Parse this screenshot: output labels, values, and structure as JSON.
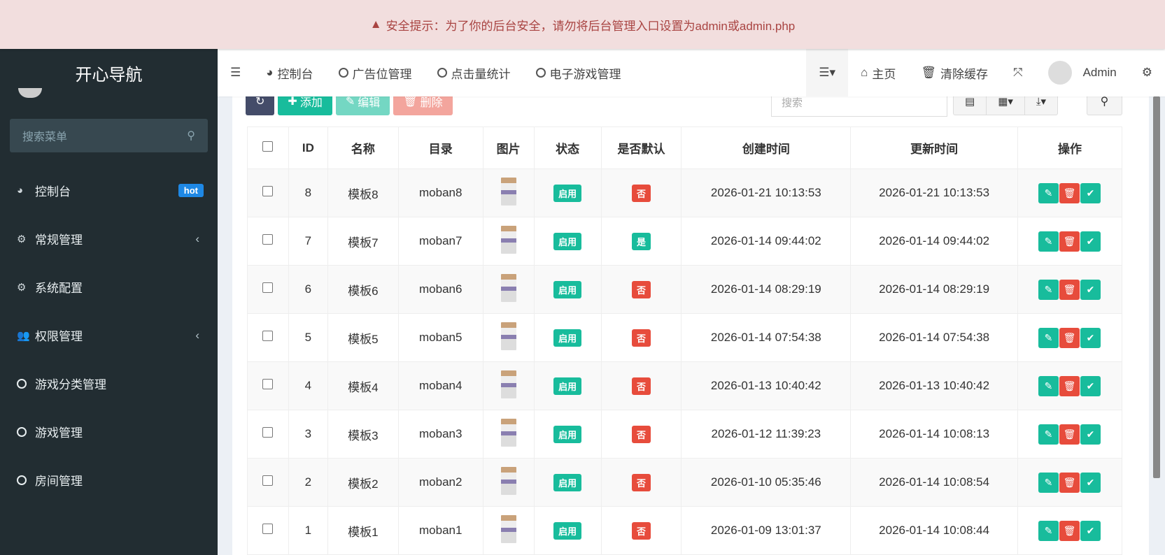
{
  "banner": {
    "text": "安全提示：为了你的后台安全，请勿将后台管理入口设置为admin或admin.php",
    "icon": "warning-icon"
  },
  "sidebar": {
    "logo": "开心导航",
    "search_placeholder": "搜索菜单",
    "items": [
      {
        "label": "控制台",
        "icon": "dashboard-icon",
        "badge": "hot"
      },
      {
        "label": "常规管理",
        "icon": "cogs-icon",
        "chevron": true
      },
      {
        "label": "系统配置",
        "icon": "cog-icon"
      },
      {
        "label": "权限管理",
        "icon": "users-icon",
        "chevron": true
      },
      {
        "label": "游戏分类管理",
        "icon": "circle-icon"
      },
      {
        "label": "游戏管理",
        "icon": "circle-icon"
      },
      {
        "label": "房间管理",
        "icon": "circle-icon"
      }
    ]
  },
  "header": {
    "tabs": [
      "控制台",
      "广告位管理",
      "点击量统计",
      "电子游戏管理"
    ],
    "home": "主页",
    "clear_cache": "清除缓存",
    "user": "Admin"
  },
  "toolbar": {
    "add": "添加",
    "edit": "编辑",
    "delete": "删除",
    "search_placeholder": "搜索"
  },
  "colors": {
    "sidebar": "#222d32",
    "success": "#18bc9c",
    "danger": "#e74c3c",
    "refresh": "#444c69"
  },
  "table": {
    "columns": [
      "ID",
      "名称",
      "目录",
      "图片",
      "状态",
      "是否默认",
      "创建时间",
      "更新时间",
      "操作"
    ],
    "rows": [
      [
        "8",
        "模板8",
        "moban8",
        "启用",
        "否",
        "2026-01-21 10:13:53",
        "2026-01-21 10:13:53"
      ],
      [
        "7",
        "模板7",
        "moban7",
        "启用",
        "是",
        "2026-01-14 09:44:02",
        "2026-01-14 09:44:02"
      ],
      [
        "6",
        "模板6",
        "moban6",
        "启用",
        "否",
        "2026-01-14 08:29:19",
        "2026-01-14 08:29:19"
      ],
      [
        "5",
        "模板5",
        "moban5",
        "启用",
        "否",
        "2026-01-14 07:54:38",
        "2026-01-14 07:54:38"
      ],
      [
        "4",
        "模板4",
        "moban4",
        "启用",
        "否",
        "2026-01-13 10:40:42",
        "2026-01-13 10:40:42"
      ],
      [
        "3",
        "模板3",
        "moban3",
        "启用",
        "否",
        "2026-01-12 11:39:23",
        "2026-01-14 10:08:13"
      ],
      [
        "2",
        "模板2",
        "moban2",
        "启用",
        "否",
        "2026-01-10 05:35:46",
        "2026-01-14 10:08:54"
      ],
      [
        "1",
        "模板1",
        "moban1",
        "启用",
        "否",
        "2026-01-09 13:01:37",
        "2026-01-14 10:08:44"
      ]
    ]
  }
}
